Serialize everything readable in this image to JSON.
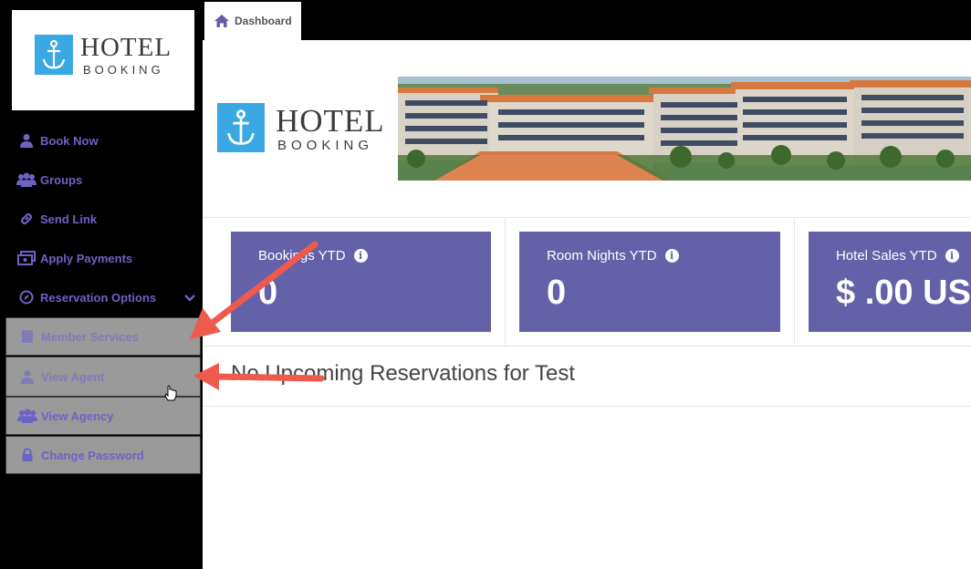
{
  "logo": {
    "word1": "HOTEL",
    "word2": "BOOKING"
  },
  "sidebar": {
    "items": [
      {
        "label": "Book Now",
        "icon": "user-icon"
      },
      {
        "label": "Groups",
        "icon": "users-icon"
      },
      {
        "label": "Send Link",
        "icon": "link-icon"
      },
      {
        "label": "Apply Payments",
        "icon": "money-icon"
      },
      {
        "label": "Reservation Options",
        "icon": "compass-icon"
      },
      {
        "label": "Member Services",
        "icon": "book-icon"
      },
      {
        "label": "View Agent",
        "icon": "user-icon"
      },
      {
        "label": "View Agency",
        "icon": "users-icon"
      },
      {
        "label": "Change Password",
        "icon": "lock-icon"
      }
    ]
  },
  "tabs": {
    "dashboard": "Dashboard"
  },
  "banner": {
    "word1": "HOTEL",
    "word2": "BOOKING"
  },
  "stats": [
    {
      "label": "Bookings YTD",
      "value": "0"
    },
    {
      "label": "Room Nights YTD",
      "value": "0"
    },
    {
      "label": "Hotel Sales YTD",
      "value": "$ .00 US"
    }
  ],
  "reservations": {
    "empty_text": "No Upcoming Reservations for Test"
  },
  "colors": {
    "accent": "#6561a8",
    "nav": "#6c63c4",
    "logo_blue": "#3aa9e3",
    "arrow": "#ee5a4c"
  }
}
